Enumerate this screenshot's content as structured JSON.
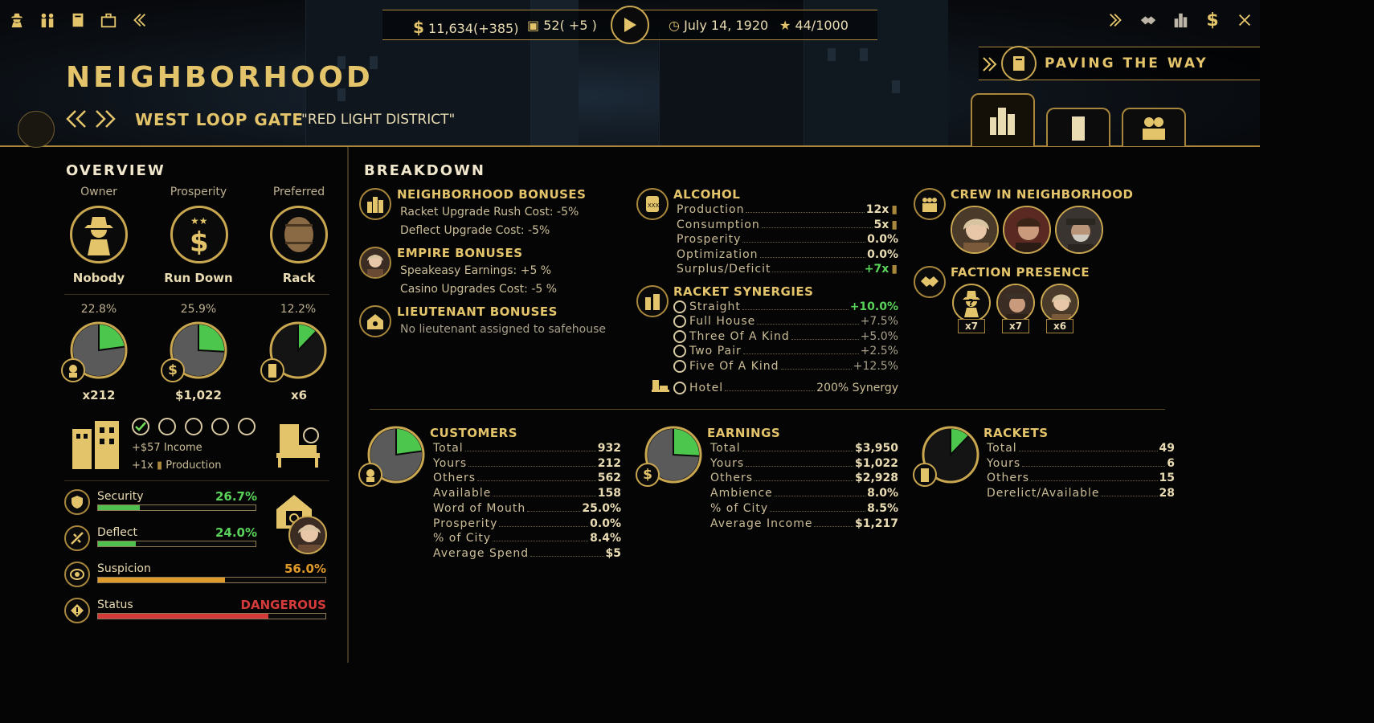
{
  "top_bar": {
    "money": "11,634",
    "money_delta": "(+385)",
    "alcohol": "52",
    "alcohol_delta": "( +5 )",
    "date": "July 14, 1920",
    "reputation": "44/1000"
  },
  "objective": {
    "title": "PAVING THE WAY"
  },
  "page": {
    "title": "NEIGHBORHOOD",
    "neighborhood_name": "WEST LOOP GATE",
    "neighborhood_nickname": "\"RED LIGHT DISTRICT\""
  },
  "overview": {
    "heading": "OVERVIEW",
    "owner_label": "Owner",
    "owner_value": "Nobody",
    "prosperity_label": "Prosperity",
    "prosperity_value": "Run Down",
    "preferred_label": "Preferred",
    "preferred_value": "Rack",
    "pies": [
      {
        "pct": "22.8%",
        "value": "x212",
        "fraction": 0.228
      },
      {
        "pct": "25.9%",
        "value": "$1,022",
        "fraction": 0.259
      },
      {
        "pct": "12.2%",
        "value": "x6",
        "fraction": 0.122
      }
    ],
    "upgrade_income": "+$57 Income",
    "upgrade_production": "+1x",
    "upgrade_production_label": "Production",
    "stats": [
      {
        "label": "Security",
        "value": "26.7%",
        "fraction": 0.267,
        "color": "#4fc04f"
      },
      {
        "label": "Deflect",
        "value": "24.0%",
        "fraction": 0.24,
        "color": "#4fc04f"
      },
      {
        "label": "Suspicion",
        "value": "56.0%",
        "fraction": 0.56,
        "color": "#e09a2a"
      },
      {
        "label": "Status",
        "value": "DANGEROUS",
        "fraction": 0.75,
        "color": "#d43a3a"
      }
    ]
  },
  "breakdown": {
    "heading": "BREAKDOWN",
    "neighborhood_bonuses": {
      "title": "NEIGHBORHOOD BONUSES",
      "lines": [
        "Racket Upgrade Rush Cost: -5%",
        "Deflect Upgrade Cost: -5%"
      ]
    },
    "empire_bonuses": {
      "title": "EMPIRE BONUSES",
      "lines": [
        "Speakeasy Earnings: +5 %",
        "Casino Upgrades Cost: -5 %"
      ]
    },
    "lieutenant_bonuses": {
      "title": "LIEUTENANT BONUSES",
      "lines": [
        "No lieutenant assigned to safehouse"
      ]
    },
    "alcohol": {
      "title": "ALCOHOL",
      "rows": [
        {
          "label": "Production",
          "value": "12x"
        },
        {
          "label": "Consumption",
          "value": "5x"
        },
        {
          "label": "Prosperity",
          "value": "0.0%"
        },
        {
          "label": "Optimization",
          "value": "0.0%"
        },
        {
          "label": "Surplus/Deficit",
          "value": "+7x"
        }
      ]
    },
    "racket_synergies": {
      "title": "RACKET SYNERGIES",
      "rows": [
        {
          "label": "Straight",
          "value": "+10.0%"
        },
        {
          "label": "Full House",
          "value": "+7.5%"
        },
        {
          "label": "Three Of A Kind",
          "value": "+5.0%"
        },
        {
          "label": "Two Pair",
          "value": "+2.5%"
        },
        {
          "label": "Five Of A Kind",
          "value": "+12.5%"
        }
      ],
      "hotel_label": "Hotel",
      "hotel_value": "200% Synergy"
    },
    "crew": {
      "title": "CREW IN NEIGHBORHOOD"
    },
    "faction": {
      "title": "FACTION PRESENCE",
      "counts": [
        "x7",
        "x7",
        "x6"
      ]
    },
    "customers": {
      "title": "CUSTOMERS",
      "fraction": 0.228,
      "rows": [
        {
          "label": "Total",
          "value": "932"
        },
        {
          "label": "Yours",
          "value": "212"
        },
        {
          "label": "Others",
          "value": "562"
        },
        {
          "label": "Available",
          "value": "158"
        },
        {
          "label": "Word of Mouth",
          "value": "25.0%"
        },
        {
          "label": "Prosperity",
          "value": "0.0%"
        },
        {
          "label": "% of City",
          "value": "8.4%"
        },
        {
          "label": "Average Spend",
          "value": "$5"
        }
      ]
    },
    "earnings": {
      "title": "EARNINGS",
      "fraction": 0.259,
      "rows": [
        {
          "label": "Total",
          "value": "$3,950"
        },
        {
          "label": "Yours",
          "value": "$1,022"
        },
        {
          "label": "Others",
          "value": "$2,928"
        },
        {
          "label": "Ambience",
          "value": "8.0%"
        },
        {
          "label": "% of City",
          "value": "8.5%"
        },
        {
          "label": "Average Income",
          "value": "$1,217"
        }
      ]
    },
    "rackets": {
      "title": "RACKETS",
      "fraction": 0.122,
      "rows": [
        {
          "label": "Total",
          "value": "49"
        },
        {
          "label": "Yours",
          "value": "6"
        },
        {
          "label": "Others",
          "value": "15"
        },
        {
          "label": "Derelict/Available",
          "value": "28"
        }
      ]
    }
  }
}
